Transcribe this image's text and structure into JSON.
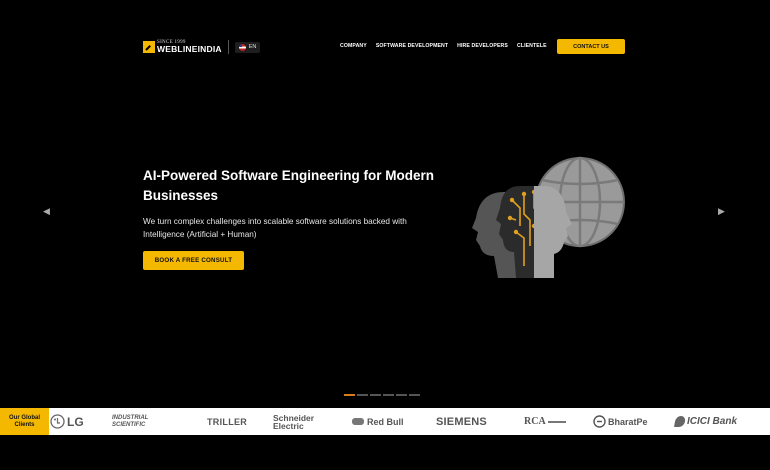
{
  "header": {
    "logo_since": "SINCE 1999",
    "logo_name": "WEBLINEINDIA",
    "lang": "EN",
    "nav": [
      "COMPANY",
      "SOFTWARE DEVELOPMENT",
      "HIRE DEVELOPERS",
      "CLIENTELE"
    ],
    "contact_label": "CONTACT US"
  },
  "hero": {
    "title": "AI-Powered Software Engineering for Modern Businesses",
    "description": "We turn complex challenges into scalable software solutions backed with Intelligence (Artificial + Human)",
    "cta_label": "BOOK A FREE CONSULT",
    "arrow_left": "◀",
    "arrow_right": "▶",
    "slide_count": 6,
    "active_slide": 0
  },
  "clients": {
    "label": "Our Global Clients",
    "brands": [
      "LG",
      "INDUSTRIAL SCIENTIFIC",
      "TRILLER",
      "Schneider Electric",
      "Red Bull",
      "SIEMENS",
      "RCA",
      "BharatPe",
      "ICICI Bank"
    ]
  },
  "colors": {
    "accent": "#f5b800",
    "background": "#000000",
    "active_dot": "#d67f1a"
  }
}
